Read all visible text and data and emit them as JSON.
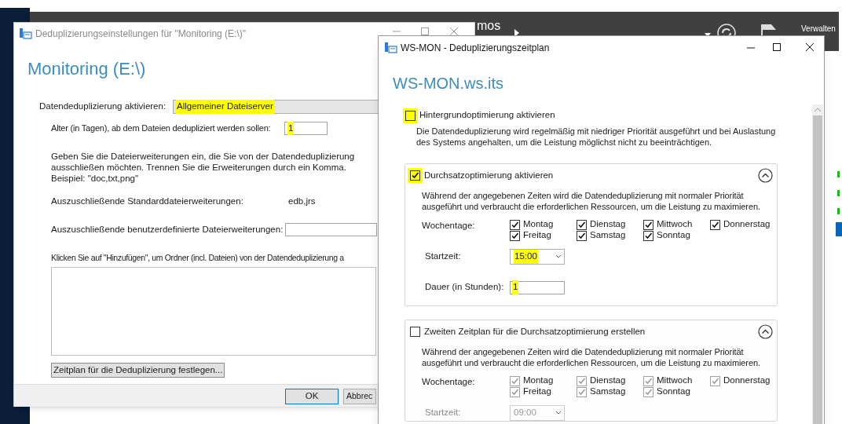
{
  "background": {
    "breadcrumb": "mos",
    "manage_menu": "Verwalten"
  },
  "left_dialog": {
    "title": "Deduplizierungseinstellungen für \"Monitoring (E:\\)\"",
    "heading": "Monitoring (E:\\)",
    "enable_label": "Datendeduplizierung aktivieren:",
    "enable_value": "Allgemeiner Dateiserver",
    "enable_highlighted": true,
    "age_label": "Alter (in Tagen), ab dem Dateien dedupliziert werden sollen:",
    "age_value": "1",
    "age_highlighted": true,
    "exclude_hint": "Geben Sie die Dateierweiterungen ein, die Sie von der Datendeduplizierung ausschließen möchten. Trennen Sie die Erweiterungen durch ein Komma. Beispiel: \"doc,txt,png\"",
    "default_ext_label": "Auszuschließende Standarddateierweiterungen:",
    "default_ext_value": "edb,jrs",
    "custom_ext_label": "Auszuschließende benutzerdefinierte Dateierweiterungen:",
    "folders_hint": "Klicken Sie auf \"Hinzufügen\", um Ordner (incl. Dateien) von der Datendeduplizierung a",
    "schedule_button": "Zeitplan für die Deduplizierung festlegen...",
    "buttons": [
      {
        "label": "OK",
        "default": true
      },
      {
        "label": "Abbrec",
        "default": false
      }
    ]
  },
  "right_dialog": {
    "title": "WS-MON - Deduplizierungszeitplan",
    "heading": "WS-MON.ws.its",
    "background_option": {
      "label": "Hintergrundoptimierung aktivieren",
      "checked": false,
      "highlighted": true,
      "description": "Die Datendeduplizierung wird regelmäßig mit niedriger Priorität ausgeführt und bei Auslastung des Systems angehalten, um die Leistung möglichst nicht zu beeinträchtigen."
    },
    "groups": [
      {
        "label": "Durchsatzoptimierung aktivieren",
        "checked": true,
        "highlighted": true,
        "disabled": false,
        "description": "Während der angegebenen Zeiten wird die Datendeduplizierung mit normaler Priorität ausgeführt und verbraucht die erforderlichen Ressourcen, um die Leistung zu maximieren.",
        "weekdays_label": "Wochentage:",
        "days": [
          {
            "label": "Montag",
            "checked": true
          },
          {
            "label": "Dienstag",
            "checked": true
          },
          {
            "label": "Mittwoch",
            "checked": true
          },
          {
            "label": "Donnerstag",
            "checked": true
          },
          {
            "label": "Freitag",
            "checked": true
          },
          {
            "label": "Samstag",
            "checked": true
          },
          {
            "label": "Sonntag",
            "checked": true
          }
        ],
        "start_label": "Startzeit:",
        "start_value": "15:00",
        "start_highlighted": true,
        "duration_label": "Dauer (in Stunden):",
        "duration_value": "1",
        "duration_highlighted": true
      },
      {
        "label": "Zweiten Zeitplan für die Durchsatzoptimierung erstellen",
        "checked": false,
        "highlighted": false,
        "disabled": true,
        "description": "Während der angegebenen Zeiten wird die Datendeduplizierung mit normaler Priorität ausgeführt und verbraucht die erforderlichen Ressourcen, um die Leistung zu maximieren.",
        "weekdays_label": "Wochentage:",
        "days": [
          {
            "label": "Montag",
            "checked": true
          },
          {
            "label": "Dienstag",
            "checked": true
          },
          {
            "label": "Mittwoch",
            "checked": true
          },
          {
            "label": "Donnerstag",
            "checked": true
          },
          {
            "label": "Freitag",
            "checked": true
          },
          {
            "label": "Samstag",
            "checked": true
          },
          {
            "label": "Sonntag",
            "checked": true
          }
        ],
        "start_label": "Startzeit:",
        "start_value": "09:00",
        "start_highlighted": false
      }
    ]
  }
}
